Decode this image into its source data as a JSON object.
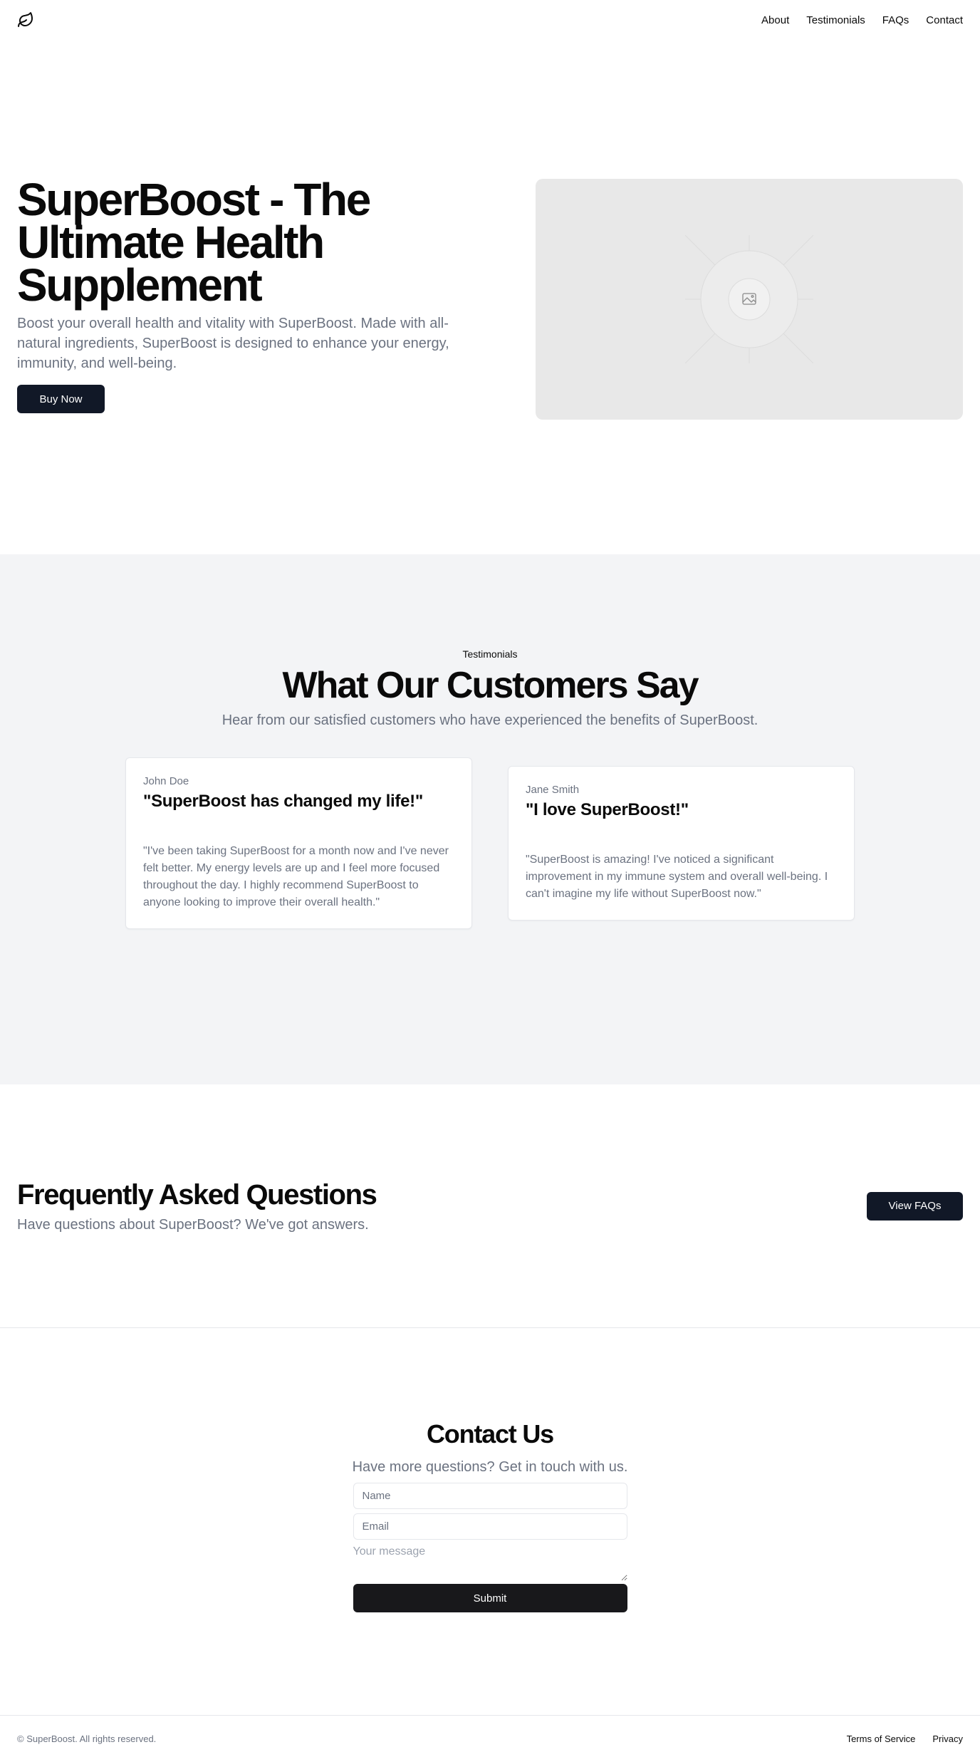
{
  "header": {
    "logo_icon": "leaf-icon",
    "nav": [
      {
        "label": "About"
      },
      {
        "label": "Testimonials"
      },
      {
        "label": "FAQs"
      },
      {
        "label": "Contact"
      }
    ]
  },
  "hero": {
    "title": "SuperBoost - The Ultimate Health Supplement",
    "description": "Boost your overall health and vitality with SuperBoost. Made with all-natural ingredients, SuperBoost is designed to enhance your energy, immunity, and well-being.",
    "cta_label": "Buy Now",
    "image_icon": "image-placeholder-icon"
  },
  "testimonials": {
    "eyebrow": "Testimonials",
    "title": "What Our Customers Say",
    "subtitle": "Hear from our satisfied customers who have experienced the benefits of SuperBoost.",
    "items": [
      {
        "name": "John Doe",
        "headline": "\"SuperBoost has changed my life!\"",
        "quote": "\"I've been taking SuperBoost for a month now and I've never felt better. My energy levels are up and I feel more focused throughout the day. I highly recommend SuperBoost to anyone looking to improve their overall health.\""
      },
      {
        "name": "Jane Smith",
        "headline": "\"I love SuperBoost!\"",
        "quote": "\"SuperBoost is amazing! I've noticed a significant improvement in my immune system and overall well-being. I can't imagine my life without SuperBoost now.\""
      }
    ]
  },
  "faq": {
    "title": "Frequently Asked Questions",
    "subtitle": "Have questions about SuperBoost? We've got answers.",
    "button_label": "View FAQs"
  },
  "contact": {
    "title": "Contact Us",
    "subtitle": "Have more questions? Get in touch with us.",
    "name_placeholder": "Name",
    "email_placeholder": "Email",
    "message_placeholder": "Your message",
    "submit_label": "Submit"
  },
  "footer": {
    "copyright": "© SuperBoost. All rights reserved.",
    "links": [
      {
        "label": "Terms of Service"
      },
      {
        "label": "Privacy"
      }
    ]
  },
  "colors": {
    "primary_button": "#111827",
    "muted_text": "#6b7280",
    "section_bg": "#f3f4f6",
    "image_placeholder_bg": "#e8e8e8"
  }
}
